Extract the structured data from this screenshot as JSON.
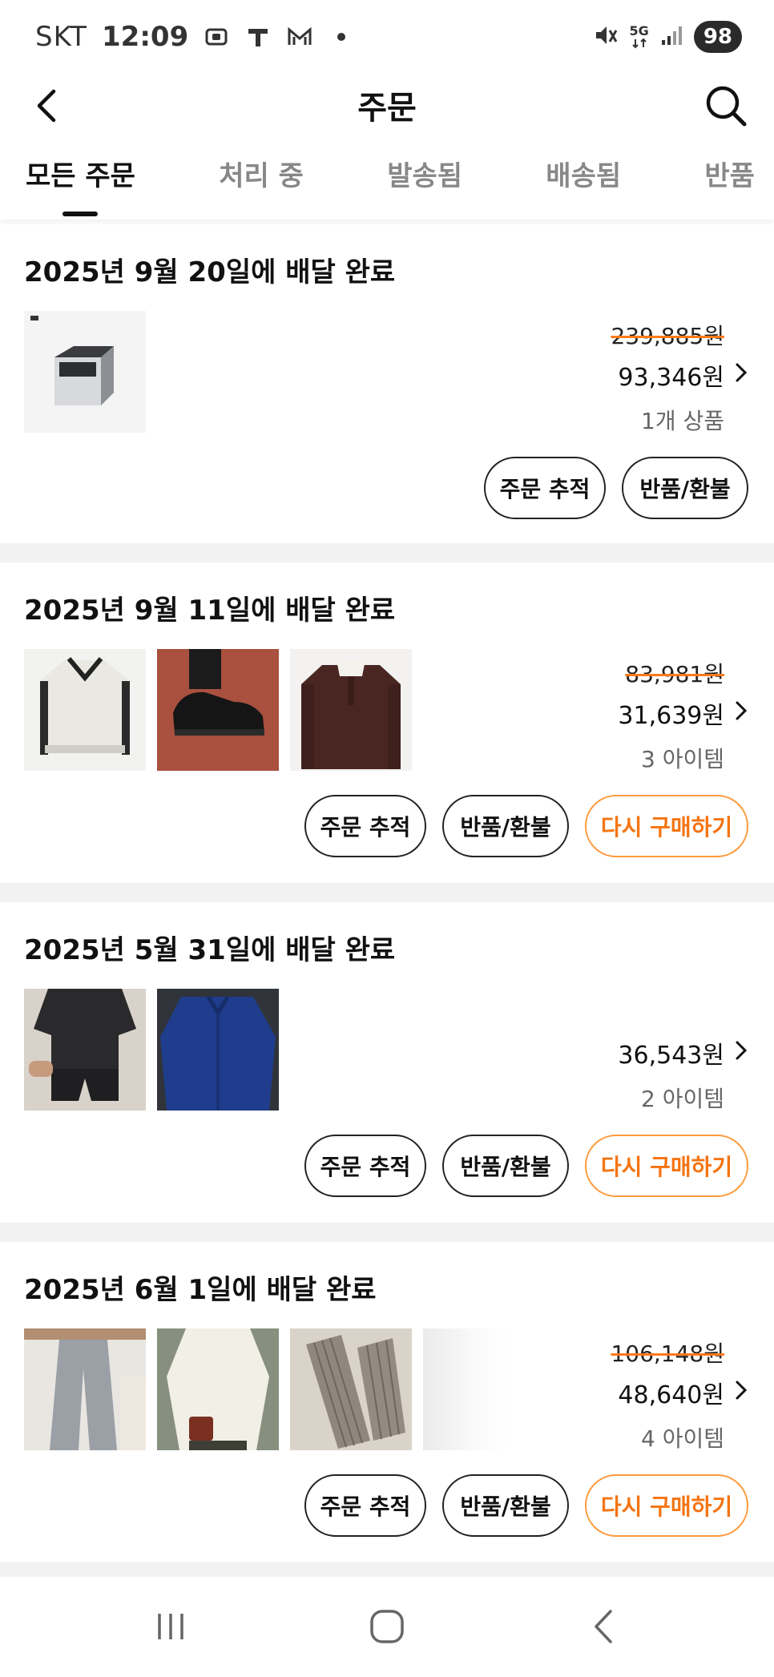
{
  "status_bar": {
    "carrier": "SKT",
    "time": "12:09",
    "battery": "98",
    "network": "5G",
    "icons": [
      "screenshot-icon",
      "t-app-icon",
      "mail-icon",
      "dot-icon",
      "mute-icon",
      "5g-icon",
      "signal-icon",
      "battery-icon"
    ]
  },
  "header": {
    "title": "주문",
    "back_icon": "back-arrow-icon",
    "search_icon": "search-icon"
  },
  "tabs": [
    {
      "label": "모든 주문",
      "active": true
    },
    {
      "label": "처리 중",
      "active": false
    },
    {
      "label": "발송됨",
      "active": false
    },
    {
      "label": "배송됨",
      "active": false
    },
    {
      "label": "반품",
      "active": false
    }
  ],
  "orders": [
    {
      "title": "2025년 9월 20일에 배달 완료",
      "original_price": "239,885원",
      "price": "93,346원",
      "count": "1개 상품",
      "buttons": [
        "주문 추적",
        "반품/환불"
      ]
    },
    {
      "title": "2025년 9월 11일에 배달 완료",
      "original_price": "83,981원",
      "price": "31,639원",
      "count": "3 아이템",
      "buttons": [
        "주문 추적",
        "반품/환불",
        "다시 구매하기"
      ]
    },
    {
      "title": "2025년 5월 31일에 배달 완료",
      "original_price": "",
      "price": "36,543원",
      "count": "2 아이템",
      "buttons": [
        "주문 추적",
        "반품/환불",
        "다시 구매하기"
      ]
    },
    {
      "title": "2025년 6월 1일에 배달 완료",
      "original_price": "106,148원",
      "price": "48,640원",
      "count": "4 아이템",
      "buttons": [
        "주문 추적",
        "반품/환불",
        "다시 구매하기"
      ]
    }
  ],
  "colors": {
    "accent": "#f57412",
    "accent_border": "#ff9a3d",
    "strike": "#ff7a1a",
    "separator": "#f2f2f2"
  },
  "nav_bar": {
    "icons": [
      "recent-apps-icon",
      "home-icon",
      "back-icon"
    ]
  }
}
